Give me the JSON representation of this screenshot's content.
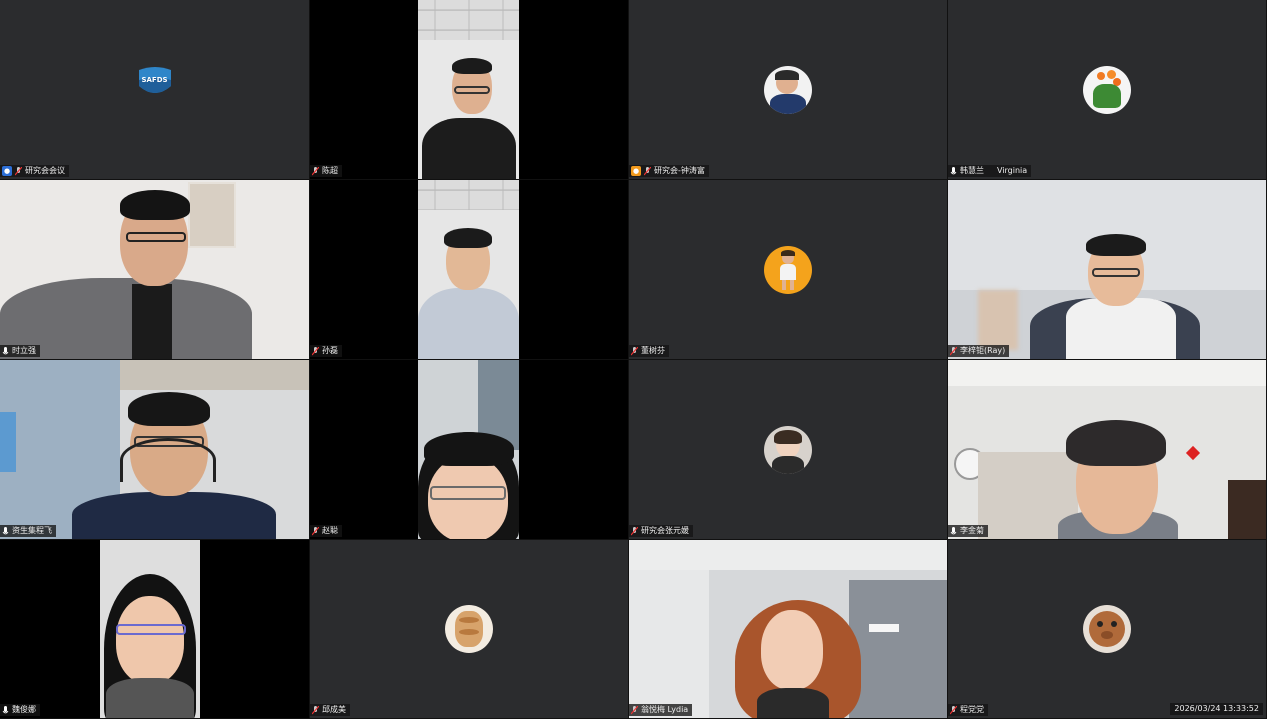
{
  "meeting": {
    "timestamp": "2026/03/24 13:33:52",
    "logo_text": "SAFDS"
  },
  "tiles": [
    {
      "name": "研究会会议",
      "badge": "host",
      "mic": "muted"
    },
    {
      "name": "陈超",
      "mic": "muted"
    },
    {
      "name": "研究会-钟涛富",
      "badge": "cohost",
      "mic": "muted"
    },
    {
      "name": "韩慧兰",
      "sub": "Virginia",
      "mic": "on"
    },
    {
      "name": "时立强",
      "mic": "on"
    },
    {
      "name": "孙磊",
      "mic": "muted"
    },
    {
      "name": "董树芬",
      "mic": "muted"
    },
    {
      "name": "李梓钜(Ray)",
      "mic": "muted"
    },
    {
      "name": "资生集程飞",
      "mic": "on"
    },
    {
      "name": "赵聪",
      "mic": "muted"
    },
    {
      "name": "研究会张元媛",
      "mic": "muted"
    },
    {
      "name": "李金菊",
      "mic": "on"
    },
    {
      "name": "魏俊娜",
      "mic": "on"
    },
    {
      "name": "邱成美",
      "mic": "muted"
    },
    {
      "name": "翁悦梅 Lydia",
      "mic": "muted"
    },
    {
      "name": "程党党",
      "mic": "muted"
    }
  ],
  "colors": {
    "active_speaker_border": "#2e9e4f",
    "host_badge": "#2d6fd6",
    "cohost_badge": "#f29a1d"
  }
}
